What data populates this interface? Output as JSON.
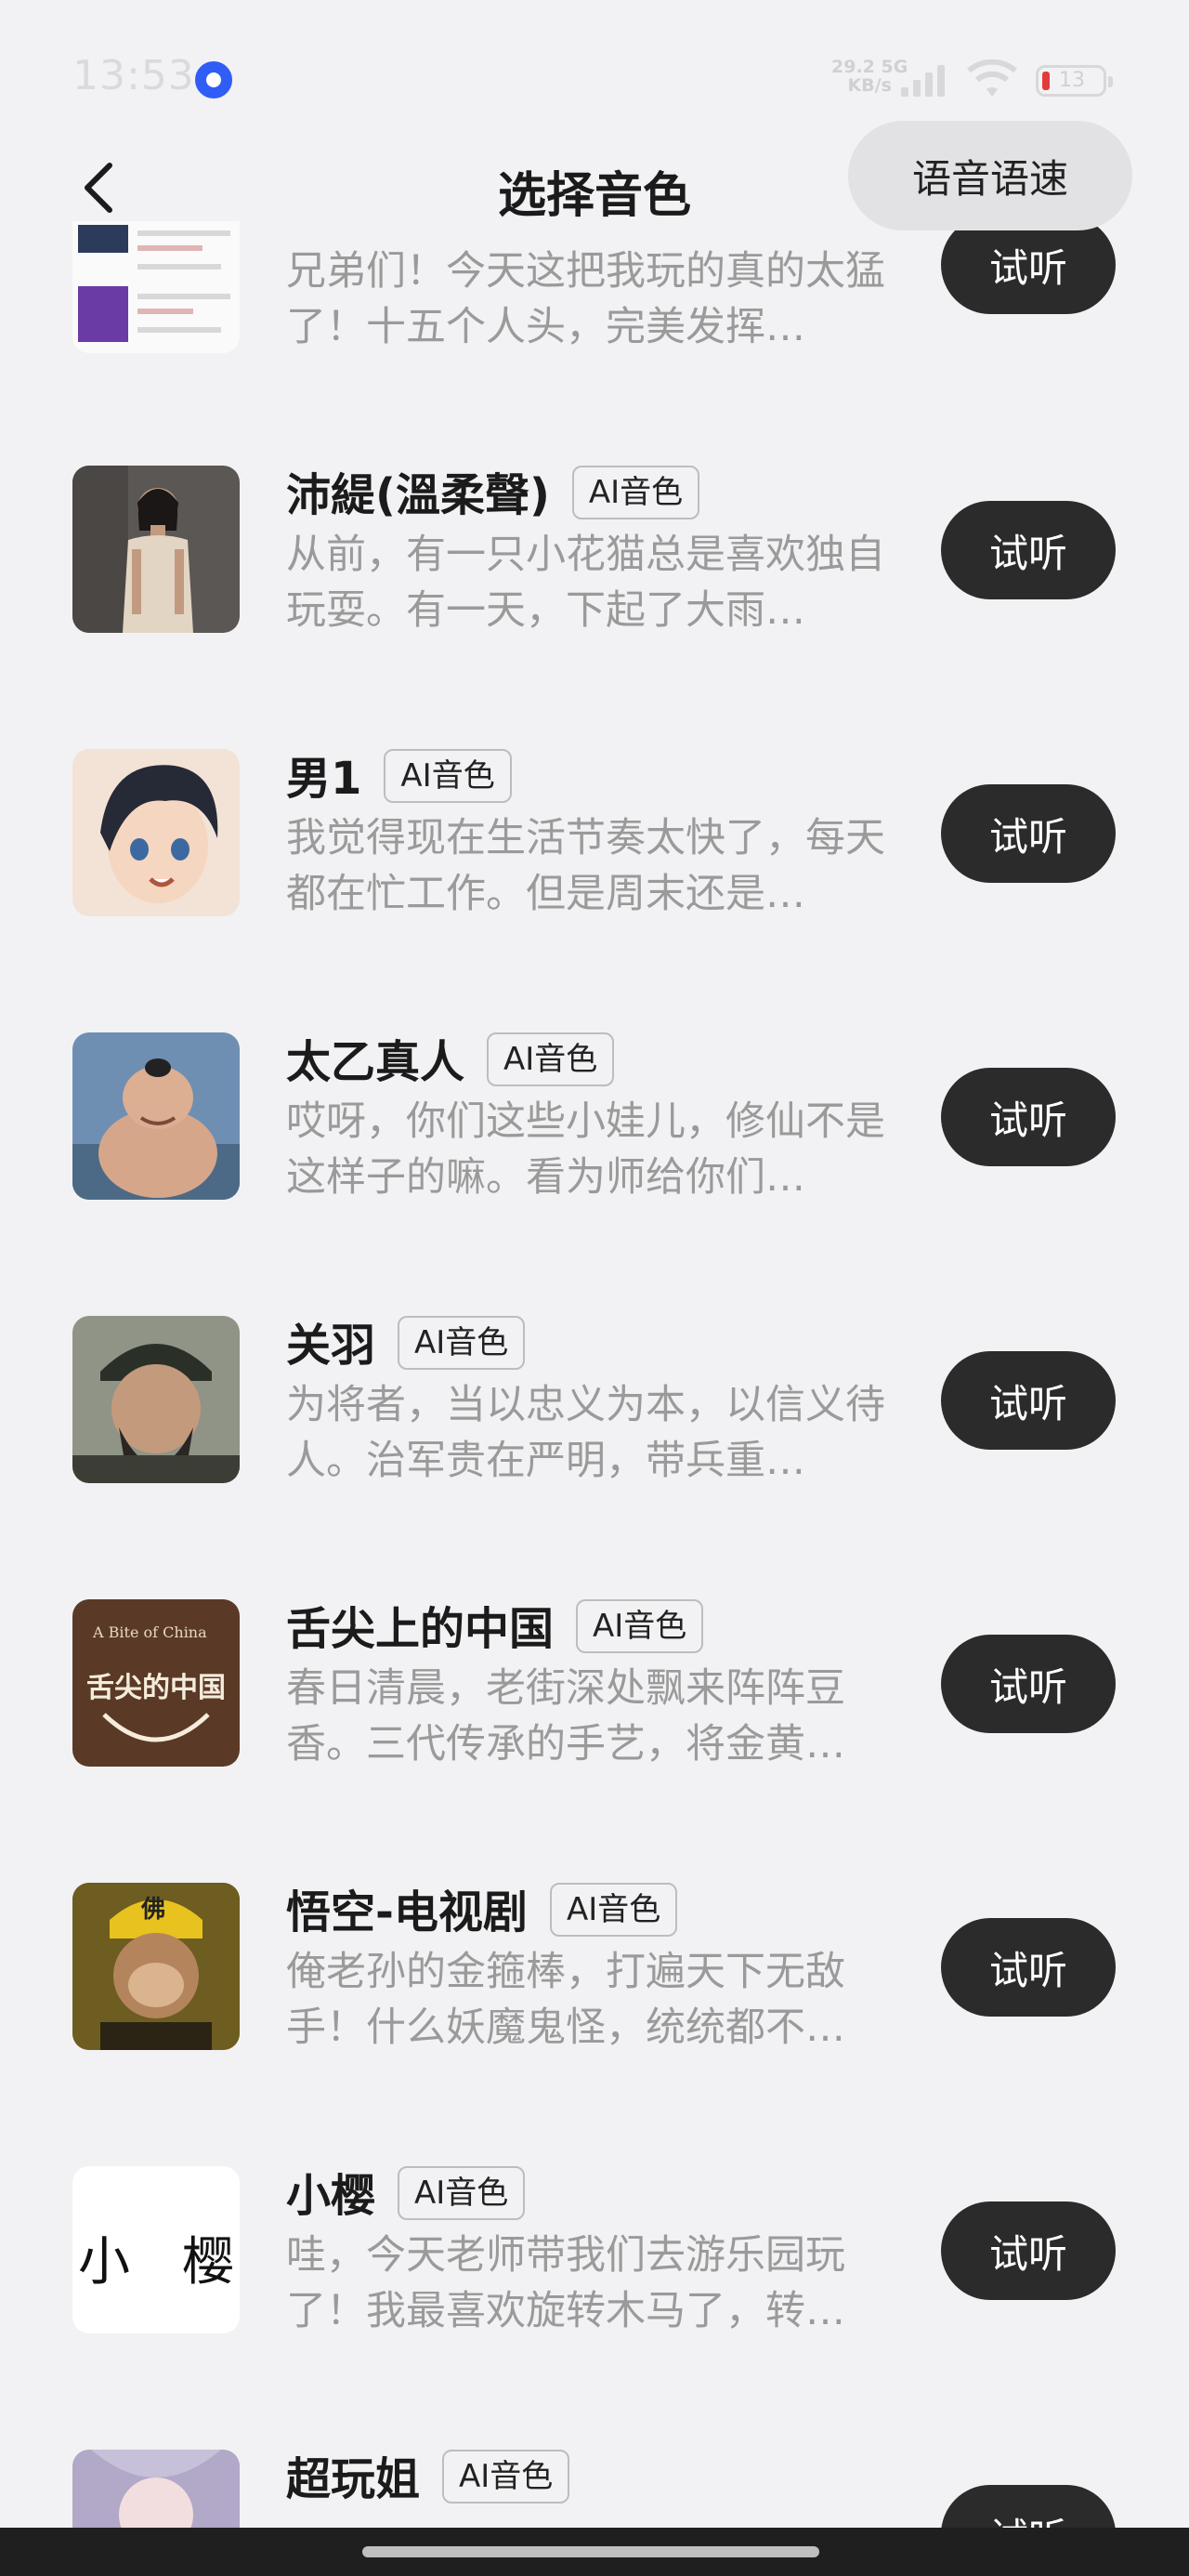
{
  "status_bar": {
    "time": "13:53",
    "net_speed": "29.2",
    "net_unit": "KB/s",
    "net_type": "5G",
    "battery": "13",
    "battery_color": "#e23b3b"
  },
  "header": {
    "title": "选择音色",
    "speed_button": "语音语速"
  },
  "listen_label": "试听",
  "badge_label": "AI音色",
  "voices": [
    {
      "name": "",
      "desc": "兄弟们！今天这把我玩的真的太猛了！十五个人头，完美发挥…",
      "thumb": "product-screenshot"
    },
    {
      "name": "沛緹(溫柔聲)",
      "desc": "从前，有一只小花猫总是喜欢独自玩耍。有一天，下起了大雨…",
      "thumb": "woman-photo"
    },
    {
      "name": "男1",
      "desc": "我觉得现在生活节奏太快了，每天都在忙工作。但是周末还是…",
      "thumb": "anime-boy"
    },
    {
      "name": "太乙真人",
      "desc": "哎呀，你们这些小娃儿，修仙不是这样子的嘛。看为师给你们…",
      "thumb": "taiyi-character"
    },
    {
      "name": "关羽",
      "desc": "为将者，当以忠义为本，以信义待人。治军贵在严明，带兵重…",
      "thumb": "guanyu-photo"
    },
    {
      "name": "舌尖上的中国",
      "desc": "春日清晨，老街深处飘来阵阵豆香。三代传承的手艺，将金黄…",
      "thumb": "documentary-logo"
    },
    {
      "name": "悟空-电视剧",
      "desc": "俺老孙的金箍棒，打遍天下无敌手！什么妖魔鬼怪，统统都不…",
      "thumb": "wukong-photo"
    },
    {
      "name": "小樱",
      "desc": "哇，今天老师带我们去游乐园玩了！我最喜欢旋转木马了，转…",
      "thumb": "text-tile"
    },
    {
      "name": "超玩姐",
      "desc": "",
      "thumb": "anime-girl"
    }
  ],
  "thumb_text": {
    "xiaoying": "小　樱",
    "documentary_logo": "舌尖的中国",
    "documentary_en": "A Bite of China",
    "wukong_hat": "佛"
  }
}
